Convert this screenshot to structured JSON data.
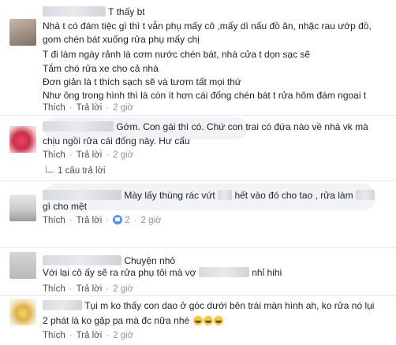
{
  "actions": {
    "like": "Thích",
    "reply": "Trả lời"
  },
  "comments": [
    {
      "author_suffix": "T thấy bt",
      "lines": [
        "Nhà t có đám tiệc gì thì t vẫn phụ mấy cô ,mấy dì nấu đồ ăn, nhặc rau ướp đồ,",
        "gom chén bát xuống rửa phụ mấy chị",
        "T đi làm ngày rảnh là cơm nước chén bát, nhà cửa t dọn sạc sẽ",
        "Tắm chó rửa xe cho cả nhà",
        "Đơn giản là t thích sạch sẽ và tươm tất mọi thứ",
        "Như ông trong hình thì là còn ít hơn cái đống chén bát t rửa hôm đám ngoại t"
      ],
      "time": "2 giờ"
    },
    {
      "lines": [
        "Gớm. Con gái thì có. Chứ con trai có đứa nào về nhà vk mà",
        "chịu ngồi rửa cái đống này. Hư cấu"
      ],
      "time": "2 giờ",
      "replies": "1 câu trả lời"
    },
    {
      "line1_a": "Mày lấy thùng rác vứt",
      "line1_b": "hết vào đó cho tao , rửa làm",
      "line2": "gì cho mệt",
      "time": "2 giờ",
      "reactions": "2"
    },
    {
      "author_suffix": "Chuyện nhỏ",
      "line2_a": "Với lại cô ấy sẽ ra rửa phụ tôi mà vợ",
      "line2_b": "nhỉ hihi",
      "time": "2 giờ"
    },
    {
      "line1": "Tụi m ko thấy con dao ở góc dưới bên trái màn hình ah, ko rửa nó lụi",
      "line2": "2 phát là ko gặp pa mà đc nữa nhé",
      "time": "2 giờ"
    }
  ]
}
